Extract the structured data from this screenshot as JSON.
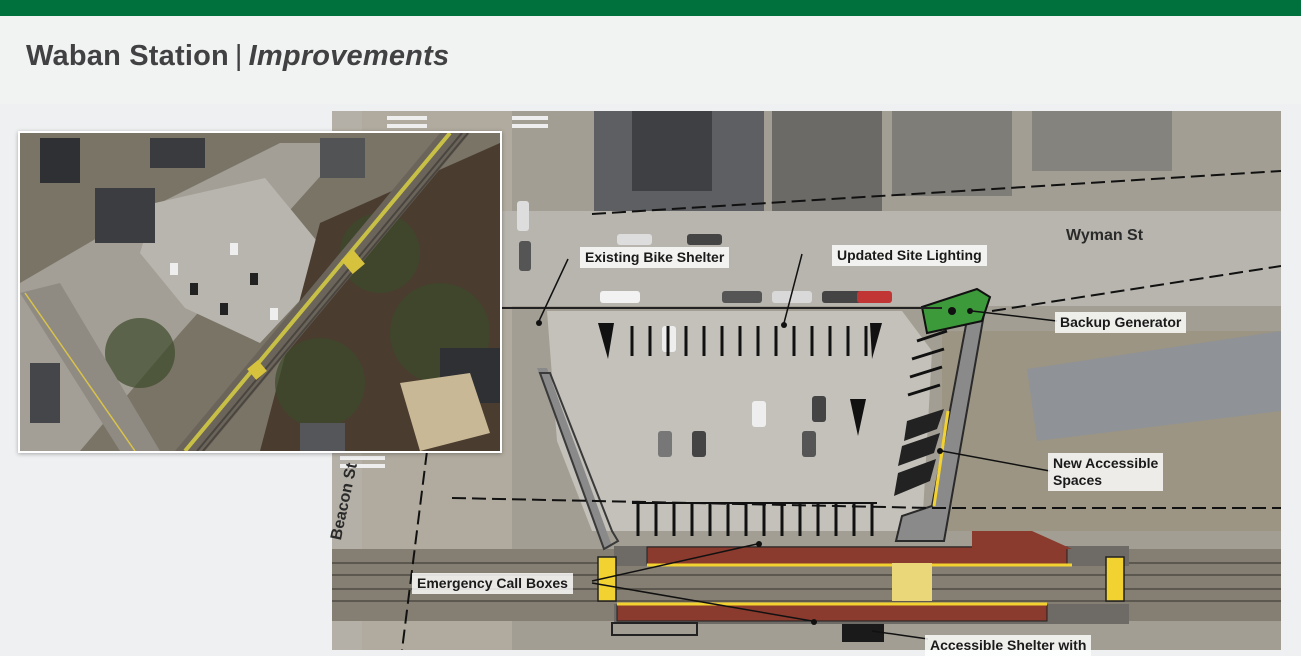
{
  "slide": {
    "title": "Waban Station",
    "separator": "|",
    "subtitle": "Improvements"
  },
  "plan": {
    "streets": {
      "wyman": "Wyman St",
      "beacon": "Beacon St"
    },
    "callouts": {
      "bike_shelter": "Existing Bike Shelter",
      "site_lighting": "Updated Site Lighting",
      "backup_generator": "Backup Generator",
      "accessible_spaces_line1": "New Accessible",
      "accessible_spaces_line2": "Spaces",
      "call_boxes": "Emergency Call Boxes",
      "accessible_shelter": "Accessible Shelter with"
    }
  },
  "colors": {
    "brand_green": "#00703c",
    "platform_red": "#8b3a2e",
    "tactile_yellow": "#f2d230",
    "generator_green": "#3c9a3a"
  }
}
